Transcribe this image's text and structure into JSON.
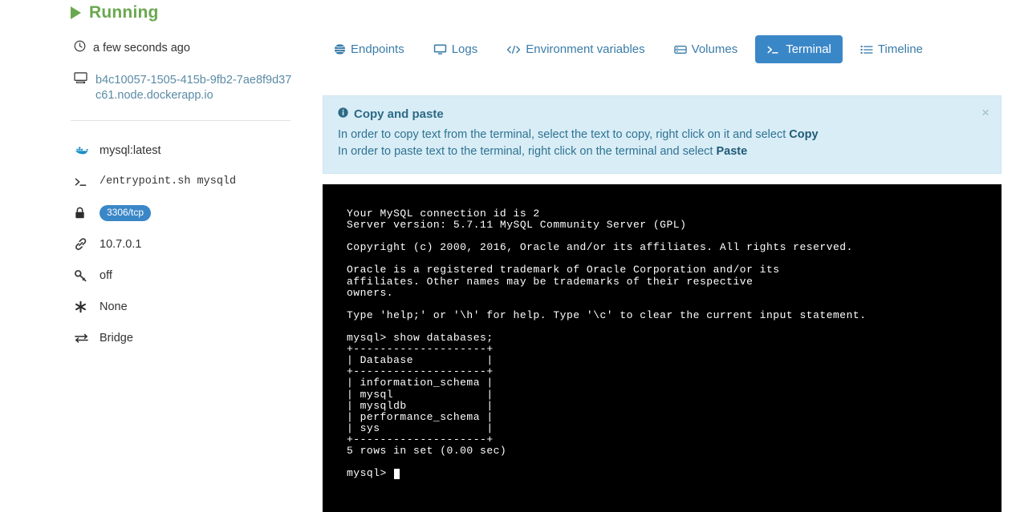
{
  "sidebar": {
    "status": {
      "icon": "play-icon",
      "label": "Running"
    },
    "timestamp": {
      "icon": "clock-icon",
      "label": "a few seconds ago"
    },
    "host": {
      "icon": "monitor-icon",
      "label": "b4c10057-1505-415b-9fb2-7ae8f9d37c61.node.dockerapp.io"
    },
    "meta": [
      {
        "icon": "docker-whale-icon",
        "label": "mysql:latest",
        "type": "text"
      },
      {
        "icon": "terminal-prompt-icon",
        "label": "/entrypoint.sh mysqld",
        "type": "mono"
      },
      {
        "icon": "lock-icon",
        "label": "3306/tcp",
        "type": "badge"
      },
      {
        "icon": "link-icon",
        "label": "10.7.0.1",
        "type": "text"
      },
      {
        "icon": "key-icon",
        "label": "off",
        "type": "text"
      },
      {
        "icon": "asterisk-icon",
        "label": "None",
        "type": "text"
      },
      {
        "icon": "exchange-icon",
        "label": "Bridge",
        "type": "text"
      }
    ]
  },
  "tabs": [
    {
      "icon": "globe-icon",
      "label": "Endpoints",
      "active": false
    },
    {
      "icon": "monitor-icon",
      "label": "Logs",
      "active": false
    },
    {
      "icon": "code-icon",
      "label": "Environment variables",
      "active": false
    },
    {
      "icon": "database-icon",
      "label": "Volumes",
      "active": false
    },
    {
      "icon": "terminal-prompt-icon",
      "label": "Terminal",
      "active": true
    },
    {
      "icon": "list-icon",
      "label": "Timeline",
      "active": false
    }
  ],
  "alert": {
    "icon": "info-icon",
    "title": "Copy and paste",
    "line1_pre": "In order to copy text from the terminal, select the text to copy, right click on it and select ",
    "line1_bold": "Copy",
    "line2_pre": "In order to paste text to the terminal, right click on the terminal and select ",
    "line2_bold": "Paste",
    "close_label": "×"
  },
  "terminal": {
    "content": "Your MySQL connection id is 2\nServer version: 5.7.11 MySQL Community Server (GPL)\n\nCopyright (c) 2000, 2016, Oracle and/or its affiliates. All rights reserved.\n\nOracle is a registered trademark of Oracle Corporation and/or its\naffiliates. Other names may be trademarks of their respective\nowners.\n\nType 'help;' or '\\h' for help. Type '\\c' to clear the current input statement.\n\nmysql> show databases;\n+--------------------+\n| Database           |\n+--------------------+\n| information_schema |\n| mysql              |\n| mysqldb            |\n| performance_schema |\n| sys                |\n+--------------------+\n5 rows in set (0.00 sec)\n\nmysql> ",
    "prompt": "mysql> ",
    "command": "show databases;",
    "connection_id": "2",
    "server_version": "5.7.11 MySQL Community Server (GPL)",
    "databases": [
      "information_schema",
      "mysql",
      "mysqldb",
      "performance_schema",
      "sys"
    ],
    "row_count_text": "5 rows in set (0.00 sec)"
  },
  "colors": {
    "status_green": "#6aa84f",
    "accent_blue": "#3a87c8",
    "link_blue": "#5b8ba6",
    "alert_bg": "#d9edf7",
    "alert_text": "#31708f",
    "terminal_bg": "#000000",
    "terminal_fg": "#ffffff"
  }
}
